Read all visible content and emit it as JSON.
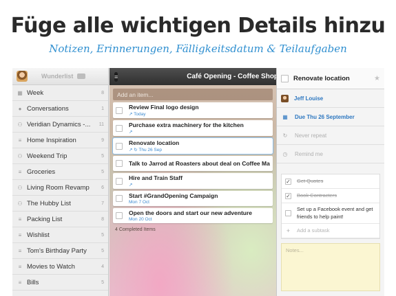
{
  "headline": "Füge alle wichtigen Details hinzu",
  "subline": "Notizen, Erinnerungen, Fälligkeitsdatum & Teilaufgaben",
  "sidebar": {
    "app_name": "Wunderlist",
    "items": [
      {
        "icon": "calendar-icon",
        "glyph": "▦",
        "label": "Week",
        "count": "8"
      },
      {
        "icon": "chat-icon",
        "glyph": "●",
        "label": "Conversations",
        "count": "1"
      },
      {
        "icon": "shared-list-icon",
        "glyph": "⚇",
        "label": "Veridian Dynamics -...",
        "count": "11"
      },
      {
        "icon": "list-icon",
        "glyph": "≡",
        "label": "Home Inspiration",
        "count": "9"
      },
      {
        "icon": "shared-list-icon",
        "glyph": "⚇",
        "label": "Weekend Trip",
        "count": "5"
      },
      {
        "icon": "list-icon",
        "glyph": "≡",
        "label": "Groceries",
        "count": "5"
      },
      {
        "icon": "shared-list-icon",
        "glyph": "⚇",
        "label": "Living Room Revamp",
        "count": "6"
      },
      {
        "icon": "shared-list-icon",
        "glyph": "⚇",
        "label": "The Hubby List",
        "count": "7"
      },
      {
        "icon": "list-icon",
        "glyph": "≡",
        "label": "Packing List",
        "count": "8"
      },
      {
        "icon": "list-icon",
        "glyph": "≡",
        "label": "Wishlist",
        "count": "5"
      },
      {
        "icon": "list-icon",
        "glyph": "≡",
        "label": "Tom's Birthday Party",
        "count": "5"
      },
      {
        "icon": "list-icon",
        "glyph": "≡",
        "label": "Movies to Watch",
        "count": "4"
      },
      {
        "icon": "list-icon",
        "glyph": "≡",
        "label": "Bills",
        "count": "5"
      }
    ]
  },
  "tasklist": {
    "title": "Café Opening - Coffee Shop",
    "add_placeholder": "Add an item...",
    "tasks": [
      {
        "title": "Review Final logo design",
        "meta": "↗ Today"
      },
      {
        "title": "Purchase extra machinery for the kitchen",
        "meta": "↗"
      },
      {
        "title": "Renovate location",
        "meta": "↗ ↻ Thu 26 Sep"
      },
      {
        "title": "Talk to Jarrod at Roasters about deal on Coffee Machines",
        "meta": ""
      },
      {
        "title": "Hire and Train Staff",
        "meta": "↗"
      },
      {
        "title": "Start #GrandOpening Campaign",
        "meta": "Mon 7 Oct"
      },
      {
        "title": "Open the doors and start our new adventure",
        "meta": "Mon 20 Oct"
      }
    ],
    "completed_note": "4 Completed Items"
  },
  "detail": {
    "title": "Renovate location",
    "assignee": "Jeff Louise",
    "due": "Due Thu 26 September",
    "repeat": "Never repeat",
    "remind": "Remind me",
    "subtasks": [
      {
        "text": "Get Quotes",
        "done": true
      },
      {
        "text": "Book Contracters",
        "done": true
      },
      {
        "text": "Set up a Facebook event and get friends to help paint!",
        "done": false
      }
    ],
    "add_subtask": "Add a subtask",
    "notes_placeholder": "Notes..."
  },
  "colors": {
    "accent": "#2f8fd0",
    "headline": "#2a2a2a",
    "notes_bg": "#fbf6d2"
  }
}
